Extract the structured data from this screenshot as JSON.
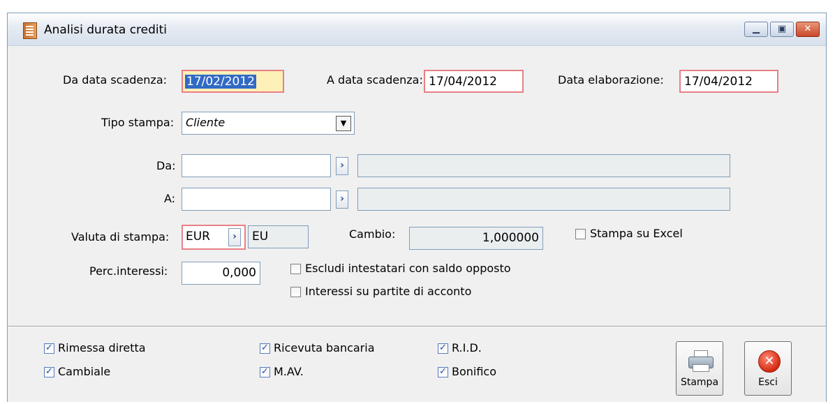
{
  "window": {
    "title": "Analisi durata crediti",
    "minimize_icon": "minimize-icon",
    "maximize_icon": "maximize-icon",
    "close_icon": "close-icon"
  },
  "form": {
    "da_data_scadenza": {
      "label": "Da data scadenza:",
      "value": "17/02/2012"
    },
    "a_data_scadenza": {
      "label": "A data scadenza:",
      "value": "17/04/2012"
    },
    "data_elaborazione": {
      "label": "Data elaborazione:",
      "value": "17/04/2012"
    },
    "tipo_stampa": {
      "label": "Tipo stampa:",
      "value": "Cliente"
    },
    "da": {
      "label": "Da:",
      "value": "",
      "descr": ""
    },
    "a": {
      "label": "A:",
      "value": "",
      "descr": ""
    },
    "valuta": {
      "label": "Valuta di stampa:",
      "value": "EUR",
      "descr": "EU"
    },
    "cambio": {
      "label": "Cambio:",
      "value": "1,000000"
    },
    "stampa_excel": {
      "label": "Stampa su Excel",
      "checked": false
    },
    "perc_interessi": {
      "label": "Perc.interessi:",
      "value": "0,000"
    },
    "escludi": {
      "label": "Escludi intestatari con saldo opposto",
      "checked": false
    },
    "interessi_acconto": {
      "label": "Interessi su partite di acconto",
      "checked": false
    }
  },
  "payment_types": {
    "rimessa": {
      "label": "Rimessa diretta",
      "checked": true
    },
    "cambiale": {
      "label": "Cambiale",
      "checked": true
    },
    "ricevuta": {
      "label": "Ricevuta bancaria",
      "checked": true
    },
    "mav": {
      "label": "M.AV.",
      "checked": true
    },
    "rid": {
      "label": "R.I.D.",
      "checked": true
    },
    "bonifico": {
      "label": "Bonifico",
      "checked": true
    }
  },
  "buttons": {
    "stampa": {
      "label": "Stampa",
      "icon": "printer-icon"
    },
    "esci": {
      "label": "Esci",
      "icon": "close-circle-icon"
    }
  },
  "colors": {
    "required_border": "#e87f86",
    "selection": "#316ac5",
    "focus_bg": "#fdf1b8"
  }
}
